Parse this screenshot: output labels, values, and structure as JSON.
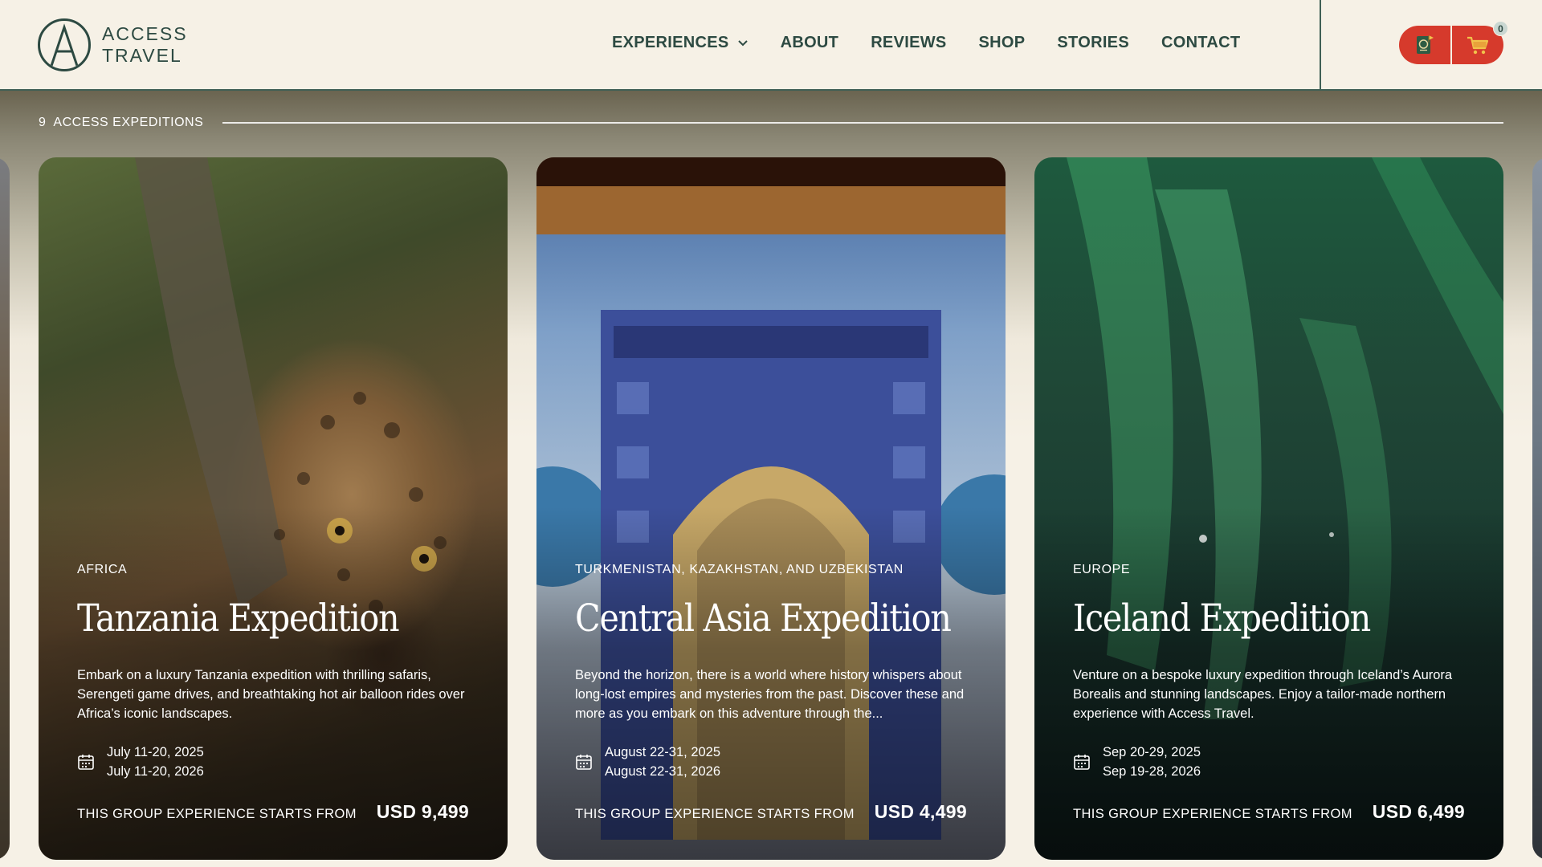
{
  "brand": {
    "name_line1": "ACCESS",
    "name_line2": "TRAVEL",
    "logo_letter": "A"
  },
  "nav": {
    "items": [
      {
        "label": "EXPERIENCES",
        "has_dropdown": true
      },
      {
        "label": "ABOUT"
      },
      {
        "label": "REVIEWS"
      },
      {
        "label": "SHOP"
      },
      {
        "label": "STORIES"
      },
      {
        "label": "CONTACT"
      }
    ]
  },
  "actions": {
    "passport_icon": "passport-icon",
    "cart_icon": "cart-icon",
    "cart_count": "0",
    "accent_color": "#d63a2c"
  },
  "section": {
    "count": "9",
    "label": "ACCESS EXPEDITIONS"
  },
  "cards": [
    {
      "region": "AFRICA",
      "title": "Tanzania Expedition",
      "description": "Embark on a luxury Tanzania expedition with thrilling safaris, Serengeti game drives, and breathtaking hot air balloon rides over Africa’s iconic landscapes.",
      "dates": [
        "July 11-20, 2025",
        "July 11-20, 2026"
      ],
      "price_label": "THIS GROUP EXPERIENCE STARTS FROM",
      "price": "USD 9,499"
    },
    {
      "region": "TURKMENISTAN, KAZAKHSTAN, AND UZBEKISTAN",
      "title": "Central Asia Expedition",
      "description": "Beyond the horizon, there is a world where history whispers about long-lost empires and mysteries from the past. Discover these and more as you embark on this adventure through the...",
      "dates": [
        "August 22-31, 2025",
        "August 22-31, 2026"
      ],
      "price_label": "THIS GROUP EXPERIENCE STARTS FROM",
      "price": "USD 4,499"
    },
    {
      "region": "EUROPE",
      "title": "Iceland Expedition",
      "description": "Venture on a bespoke luxury expedition through Iceland’s Aurora Borealis and stunning landscapes. Enjoy a tailor-made northern experience with Access Travel.",
      "dates": [
        "Sep 20-29, 2025",
        "Sep 19-28, 2026"
      ],
      "price_label": "THIS GROUP EXPERIENCE STARTS FROM",
      "price": "USD 6,499"
    }
  ],
  "colors": {
    "brand_green": "#2d4a42",
    "cream": "#f6f1e6"
  }
}
